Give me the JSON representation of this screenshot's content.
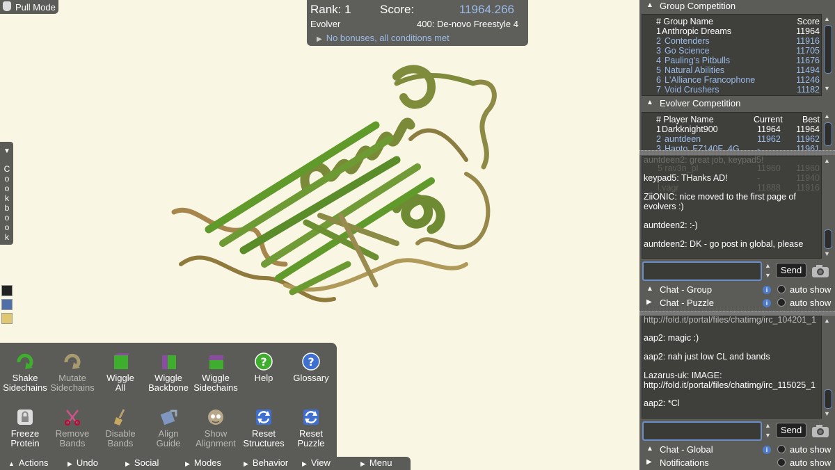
{
  "top_left": {
    "mode_label": "Pull Mode"
  },
  "score_panel": {
    "rank_label": "Rank: 1",
    "score_label": "Score:",
    "score_value": "11964.266",
    "player_type": "Evolver",
    "puzzle_name": "400: De-novo Freestyle 4",
    "bonus_text": "No bonuses, all conditions met"
  },
  "cookbook": {
    "label": "Cookbook",
    "letters": [
      "C",
      "o",
      "o",
      "k",
      "b",
      "o",
      "o",
      "k"
    ]
  },
  "actions": {
    "tools": [
      {
        "label1": "Shake",
        "label2": "Sidechains",
        "icon": "shake-icon",
        "enabled": true
      },
      {
        "label1": "Mutate",
        "label2": "Sidechains",
        "icon": "mutate-icon",
        "enabled": false
      },
      {
        "label1": "Wiggle",
        "label2": "All",
        "icon": "wiggle-all-icon",
        "enabled": true
      },
      {
        "label1": "Wiggle",
        "label2": "Backbone",
        "icon": "wiggle-backbone-icon",
        "enabled": true
      },
      {
        "label1": "Wiggle",
        "label2": "Sidechains",
        "icon": "wiggle-sidechains-icon",
        "enabled": true
      },
      {
        "label1": "Help",
        "label2": "",
        "icon": "help-icon",
        "enabled": true
      },
      {
        "label1": "Glossary",
        "label2": "",
        "icon": "glossary-icon",
        "enabled": true
      },
      {
        "label1": "Freeze",
        "label2": "Protein",
        "icon": "lock-icon",
        "enabled": true
      },
      {
        "label1": "Remove",
        "label2": "Bands",
        "icon": "scissors-icon",
        "enabled": false
      },
      {
        "label1": "Disable",
        "label2": "Bands",
        "icon": "broom-icon",
        "enabled": false
      },
      {
        "label1": "Align",
        "label2": "Guide",
        "icon": "align-icon",
        "enabled": false
      },
      {
        "label1": "Show",
        "label2": "Alignment",
        "icon": "alignment-icon",
        "enabled": false
      },
      {
        "label1": "Reset",
        "label2": "Structures",
        "icon": "reset-structures-icon",
        "enabled": true
      },
      {
        "label1": "Reset",
        "label2": "Puzzle",
        "icon": "reset-puzzle-icon",
        "enabled": true
      }
    ]
  },
  "menubar": {
    "items": [
      {
        "label": "Actions",
        "tri": "▲"
      },
      {
        "label": "Undo",
        "tri": "▶"
      },
      {
        "label": "Social",
        "tri": "▶"
      },
      {
        "label": "Modes",
        "tri": "▶"
      },
      {
        "label": "Behavior",
        "tri": "▶"
      },
      {
        "label": "View",
        "tri": "▶"
      },
      {
        "label": "Menu",
        "tri": "▶"
      }
    ]
  },
  "group_competition": {
    "title": "Group Competition",
    "headers": {
      "rank_name": "# Group Name",
      "score": "Score"
    },
    "rows": [
      {
        "rank": "1",
        "name": "Anthropic Dreams",
        "score": "11964",
        "highlight": false
      },
      {
        "rank": "2",
        "name": "Contenders",
        "score": "11916",
        "highlight": true
      },
      {
        "rank": "3",
        "name": "Go Science",
        "score": "11705",
        "highlight": true
      },
      {
        "rank": "4",
        "name": "Pauling's Pitbulls",
        "score": "11676",
        "highlight": true
      },
      {
        "rank": "5",
        "name": "Natural Abilities",
        "score": "11494",
        "highlight": true
      },
      {
        "rank": "6",
        "name": "L'Alliance Francophone",
        "score": "11246",
        "highlight": true
      },
      {
        "rank": "7",
        "name": "Void Crushers",
        "score": "11182",
        "highlight": true
      }
    ]
  },
  "evolver_competition": {
    "title": "Evolver Competition",
    "headers": {
      "rank_name": "# Player Name",
      "current": "Current",
      "best": "Best"
    },
    "rows": [
      {
        "rank": "1",
        "name": "Darkknight900",
        "current": "11964",
        "best": "11964",
        "highlight": false
      },
      {
        "rank": "2",
        "name": "auntdeen",
        "current": "11962",
        "best": "11962",
        "highlight": true
      },
      {
        "rank": "3",
        "name": "Hanto_FZ140F_4G",
        "current": "-",
        "best": "11961",
        "highlight": true
      }
    ],
    "ghost_rows": [
      {
        "text": "5 rav3n_pl",
        "current": "11960",
        "best": "11960"
      },
      {
        "text": "",
        "current": "-",
        "best": "11940"
      },
      {
        "text": "l.vagr",
        "current": "11888",
        "best": "11916"
      }
    ]
  },
  "group_chat": {
    "top_fragment": "auntdeen2: great job, keypad5!",
    "messages": [
      {
        "user": "keypad5:",
        "text": " THanks AD!"
      },
      {
        "user": "ZiiONIC:",
        "text": " nice moved to the first page of evolvers :)"
      },
      {
        "user": "auntdeen2:",
        "text": " :-)"
      },
      {
        "user": "auntdeen2:",
        "text": " DK - go post in global, please"
      }
    ],
    "send_label": "Send",
    "input_value": ""
  },
  "chat_tabs": [
    {
      "label": "Chat - Group",
      "tri": "▲",
      "auto": "auto show"
    },
    {
      "label": "Chat - Puzzle",
      "tri": "▶",
      "auto": "auto show"
    }
  ],
  "global_chat": {
    "top_fragment": "http://fold.it/portal/files/chatimg/irc_104201_1",
    "messages": [
      {
        "user": "aap2:",
        "text": " magic :)"
      },
      {
        "user": "aap2:",
        "text": " nah just low CL and bands"
      },
      {
        "user": "Lazarus-uk:",
        "text": " IMAGE: http://fold.it/portal/files/chatimg/irc_115025_1"
      },
      {
        "user": "aap2:",
        "text": " *Cl"
      }
    ],
    "send_label": "Send",
    "input_value": ""
  },
  "bottom_tabs": [
    {
      "label": "Chat - Global",
      "tri": "▲",
      "auto": "auto show",
      "info": true
    },
    {
      "label": "Notifications",
      "tri": "▶",
      "auto": "auto show",
      "info": false
    }
  ],
  "colors": {
    "accent": "#9bbbe8",
    "panel": "#5b5b57",
    "background": "#f9f6e3",
    "protein_green": "#5f9a2a",
    "protein_tan": "#a7864e"
  }
}
